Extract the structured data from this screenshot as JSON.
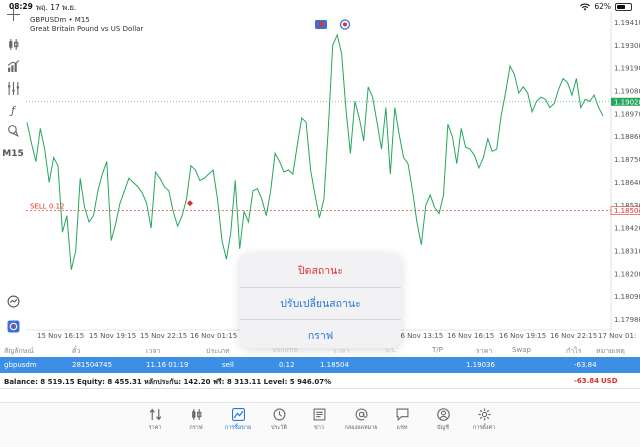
{
  "status_bar": {
    "time": "08:29",
    "date": "พฤ. 17 พ.ย.",
    "battery": "62%",
    "battery_level": 0.62
  },
  "chart": {
    "symbol_line": "GBPUSDm • M15",
    "description": "Great Britain Pound vs US Dollar",
    "timeframe": "M15",
    "price_labels": [
      "1.19410",
      "1.19300",
      "1.19190",
      "1.19080",
      "1.18970",
      "1.18860",
      "1.18750",
      "1.18640",
      "1.18530",
      "1.18420",
      "1.18310",
      "1.18200",
      "1.18090",
      "1.17980"
    ],
    "current_price": "1.19028",
    "sell_line_label": "SELL 0.12",
    "sell_price_label": "1.18504",
    "time_labels": [
      "15 Nov 16:15",
      "15 Nov 19:15",
      "15 Nov 22:15",
      "16 Nov 01:15",
      "16 Nov 13:15",
      "16 Nov 16:15",
      "16 Nov 19:15",
      "16 Nov 22:15",
      "17 Nov 01:"
    ],
    "colors": {
      "line": "#26a65b",
      "current_price_bg": "#26a65b",
      "sell_line": "#e0302a"
    }
  },
  "chart_data": {
    "type": "line",
    "xlabel": "",
    "ylabel": "",
    "ylim": [
      1.1793,
      1.1946
    ],
    "x_tick_labels": [
      "15 Nov 16:15",
      "15 Nov 19:15",
      "15 Nov 22:15",
      "16 Nov 01:15",
      "16 Nov 13:15",
      "16 Nov 16:15",
      "16 Nov 19:15",
      "16 Nov 22:15",
      "17 Nov 01:"
    ],
    "y_tick_labels": [
      "1.19410",
      "1.19300",
      "1.19190",
      "1.19080",
      "1.18970",
      "1.18860",
      "1.18750",
      "1.18640",
      "1.18530",
      "1.18420",
      "1.18310",
      "1.18200",
      "1.18090",
      "1.17980"
    ],
    "series": [
      {
        "values": [
          1.1893,
          1.1883,
          1.1874,
          1.189,
          1.188,
          1.1864,
          1.1876,
          1.1872,
          1.184,
          1.1848,
          1.1822,
          1.1831,
          1.1866,
          1.1852,
          1.1845,
          1.1848,
          1.186,
          1.1868,
          1.1874,
          1.1836,
          1.1844,
          1.1854,
          1.186,
          1.1866,
          1.1864,
          1.1862,
          1.1859,
          1.1854,
          1.1842,
          1.1869,
          1.1866,
          1.1862,
          1.186,
          1.185,
          1.1843,
          1.1848,
          1.1856,
          1.1872,
          1.187,
          1.1865,
          1.1866,
          1.1868,
          1.187,
          1.1856,
          1.1836,
          1.1827,
          1.184,
          1.1865,
          1.1832,
          1.185,
          1.1845,
          1.186,
          1.1861,
          1.1856,
          1.1848,
          1.186,
          1.1878,
          1.1874,
          1.1869,
          1.187,
          1.1868,
          1.1882,
          1.1895,
          1.1893,
          1.187,
          1.1858,
          1.1847,
          1.1856,
          1.189,
          1.193,
          1.1935,
          1.1926,
          1.1899,
          1.1878,
          1.1903,
          1.1895,
          1.1884,
          1.191,
          1.1905,
          1.1893,
          1.188,
          1.19,
          1.1868,
          1.19,
          1.1887,
          1.1876,
          1.1873,
          1.186,
          1.1845,
          1.1834,
          1.1853,
          1.1858,
          1.1852,
          1.1849,
          1.1858,
          1.1892,
          1.1886,
          1.1873,
          1.189,
          1.1881,
          1.188,
          1.1877,
          1.1871,
          1.1876,
          1.1885,
          1.1879,
          1.188,
          1.1896,
          1.1907,
          1.192,
          1.1916,
          1.1907,
          1.191,
          1.1907,
          1.1898,
          1.1903,
          1.1905,
          1.1904,
          1.19,
          1.1902,
          1.1909,
          1.1914,
          1.1912,
          1.1906,
          1.1914,
          1.19,
          1.1904,
          1.1903,
          1.1906,
          1.19,
          1.1896
        ]
      }
    ],
    "grid": false,
    "current_price": 1.19028,
    "sell_price": 1.18504
  },
  "table": {
    "headers": [
      "สัญลักษณ์",
      "ตั๋ว",
      "เวลา",
      "ประเภท",
      "Volume",
      "ราคา",
      "S/L",
      "T/P",
      "ราคา",
      "Swap",
      "กำไร",
      "หมายเหตุ"
    ],
    "row": [
      "gbpusdm",
      "281504745",
      "11.16 01:19",
      "sell",
      "0.12",
      "1.18504",
      "",
      "",
      "1.19036",
      "",
      "-63.84",
      ""
    ]
  },
  "balance": {
    "text": "Balance: 8 519.15 Equity: 8 455.31 หลักประกัน: 142.20 ฟรี: 8 313.11 Level: 5 946.07%",
    "profit": "-63.84",
    "currency": "USD"
  },
  "context_menu": {
    "items": [
      {
        "label": "ปิดสถานะ",
        "style": "danger"
      },
      {
        "label": "ปรับเปลี่ยนสถานะ",
        "style": "action"
      },
      {
        "label": "กราฟ",
        "style": "action"
      }
    ]
  },
  "bottom_nav": {
    "items": [
      {
        "label": "ราคา",
        "icon": "quotes-icon"
      },
      {
        "label": "กราฟ",
        "icon": "chart-icon"
      },
      {
        "label": "การซื้อขาย",
        "icon": "trade-icon",
        "active": true
      },
      {
        "label": "ประวัติ",
        "icon": "history-icon"
      },
      {
        "label": "ข่าว",
        "icon": "news-icon"
      },
      {
        "label": "กล่องจดหมาย",
        "icon": "mailbox-icon"
      },
      {
        "label": "แชท",
        "icon": "chat-icon"
      },
      {
        "label": "บัญชี",
        "icon": "account-icon"
      },
      {
        "label": "การตั้งค่า",
        "icon": "settings-icon"
      }
    ]
  }
}
